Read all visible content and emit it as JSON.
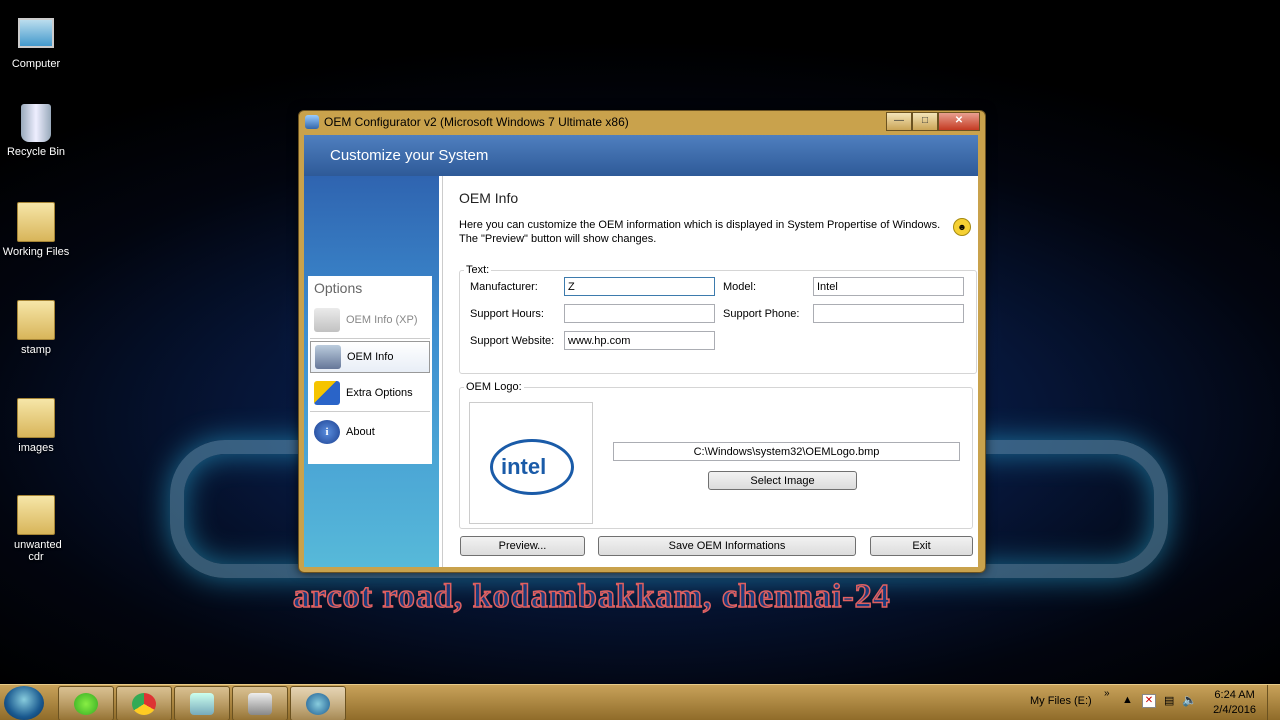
{
  "desktop": {
    "icons": [
      {
        "label": "Computer"
      },
      {
        "label": "Recycle Bin"
      },
      {
        "label": "Working Files"
      },
      {
        "label": "stamp"
      },
      {
        "label": "images"
      },
      {
        "label": "unwanted cdr"
      }
    ],
    "caption": "arcot road, kodambakkam, chennai-24"
  },
  "window": {
    "title": "OEM Configurator v2 (Microsoft Windows 7 Ultimate  x86)",
    "header": "Customize your System",
    "options_title": "Options",
    "options": [
      {
        "label": "OEM Info (XP)",
        "icon": "computer-icon",
        "state": "disabled"
      },
      {
        "label": "OEM Info",
        "icon": "monitor-icon",
        "state": "selected"
      },
      {
        "label": "Extra Options",
        "icon": "blocks-icon",
        "state": "normal"
      },
      {
        "label": "About",
        "icon": "info-icon",
        "state": "normal"
      }
    ],
    "main": {
      "heading": "OEM Info",
      "description_line1": "Here you can customize the OEM information which is displayed in System Propertise of Windows.",
      "description_line2": "The \"Preview\" button will show changes.",
      "text_group": "Text:",
      "manufacturer_label": "Manufacturer:",
      "manufacturer_value": "Z",
      "model_label": "Model:",
      "model_value": "Intel",
      "support_hours_label": "Support Hours:",
      "support_hours_value": "",
      "support_phone_label": "Support Phone:",
      "support_phone_value": "",
      "support_website_label": "Support Website:",
      "support_website_value": "www.hp.com",
      "logo_group": "OEM Logo:",
      "logo_text": "intel",
      "logo_path": "C:\\Windows\\system32\\OEMLogo.bmp",
      "select_image": "Select Image",
      "preview": "Preview...",
      "save": "Save OEM Informations",
      "exit": "Exit"
    }
  },
  "taskbar": {
    "items": [
      "start-orb-icon",
      "cdr-app-icon",
      "chrome-icon",
      "explorer-icon",
      "camera-app-icon",
      "oem-configurator-icon"
    ],
    "tray_label": "My Files (E:)",
    "time": "6:24 AM",
    "date": "2/4/2016"
  },
  "colors": {
    "header": "#2e5a98",
    "window_frame": "#c9a24c",
    "taskbar": "#a8823c"
  }
}
